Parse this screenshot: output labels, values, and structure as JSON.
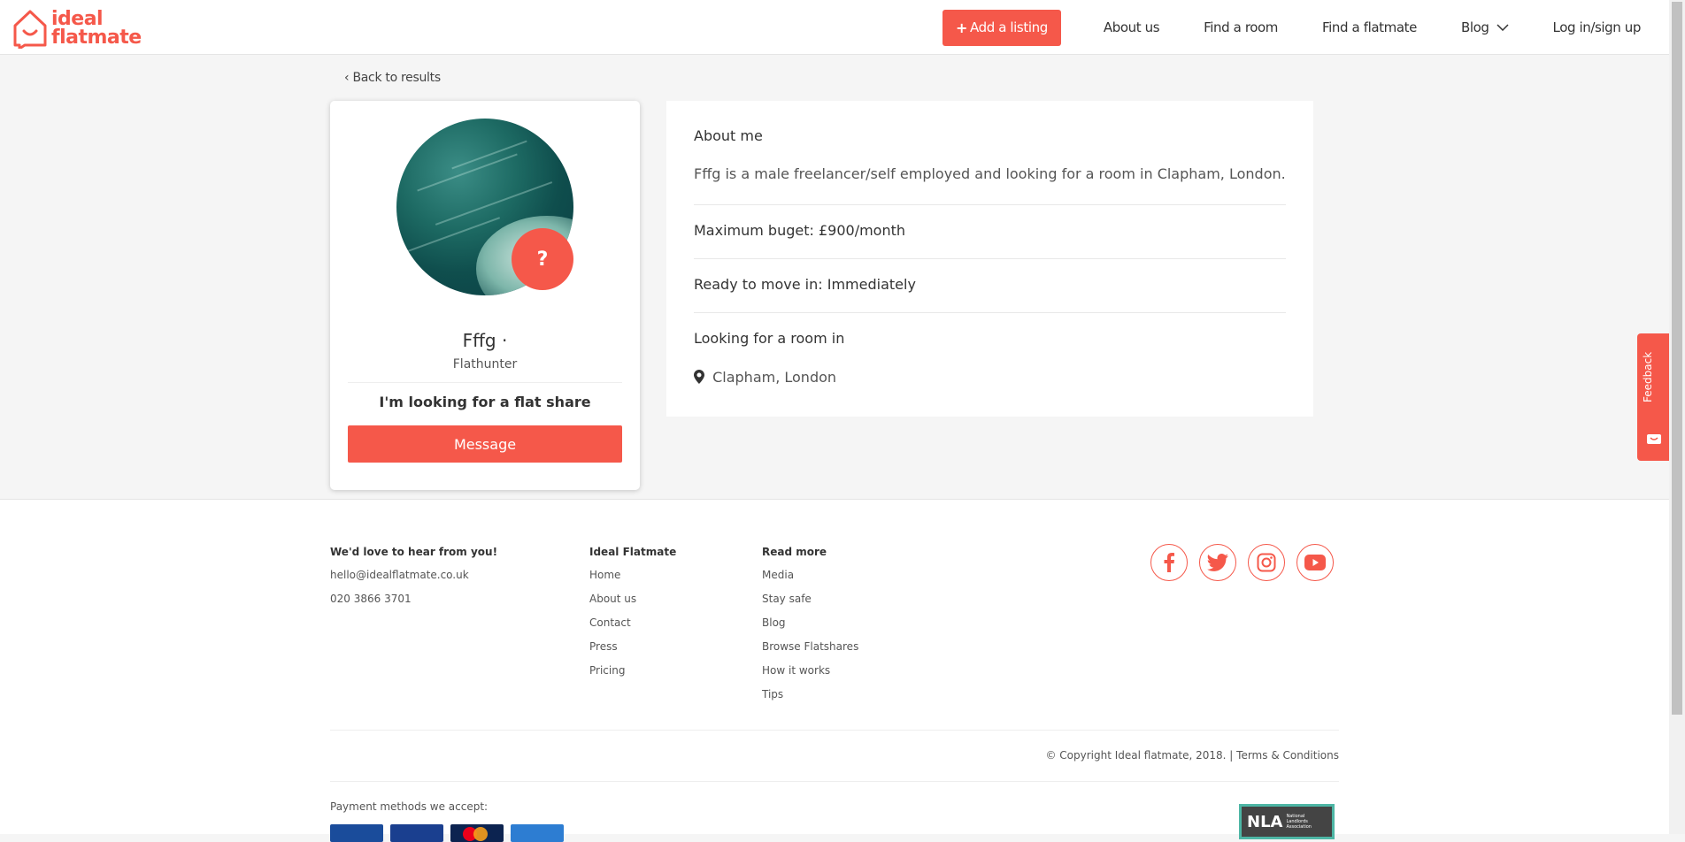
{
  "header": {
    "logo_line1": "ideal",
    "logo_line2": "flatmate",
    "add_listing": "Add a listing",
    "nav": [
      "About us",
      "Find a room",
      "Find a flatmate",
      "Blog",
      "Log in/sign up"
    ]
  },
  "back_link": "Back to results",
  "profile": {
    "badge": "?",
    "name": "Fffg ·",
    "role": "Flathunter",
    "looking": "I'm looking for a flat share",
    "message_button": "Message"
  },
  "details": {
    "about_heading": "About me",
    "about_text": "Fffg is a male freelancer/self employed and looking for a room in Clapham, London.",
    "budget": "Maximum buget: £900/month",
    "move_in": "Ready to move in: Immediately",
    "area_heading": "Looking for a room in",
    "area": "Clapham, London"
  },
  "feedback": "Feedback",
  "footer": {
    "contact": {
      "heading": "We'd love to hear from you!",
      "email": "hello@idealflatmate.co.uk",
      "phone": "020 3866 3701"
    },
    "ideal": {
      "heading": "Ideal Flatmate",
      "links": [
        "Home",
        "About us",
        "Contact",
        "Press",
        "Pricing"
      ]
    },
    "read_more": {
      "heading": "Read more",
      "links": [
        "Media",
        "Stay safe",
        "Blog",
        "Browse Flatshares",
        "How it works",
        "Tips"
      ]
    },
    "social_icons": [
      "facebook-icon",
      "twitter-icon",
      "instagram-icon",
      "youtube-icon"
    ],
    "copyright": "© Copyright Ideal flatmate, 2018. | Terms & Conditions",
    "payments_label": "Payment methods we accept:",
    "nla": "NLA",
    "nla_small": "National Landlords Association"
  },
  "colors": {
    "brand": "#f5584a",
    "background": "#f5f5f5"
  }
}
